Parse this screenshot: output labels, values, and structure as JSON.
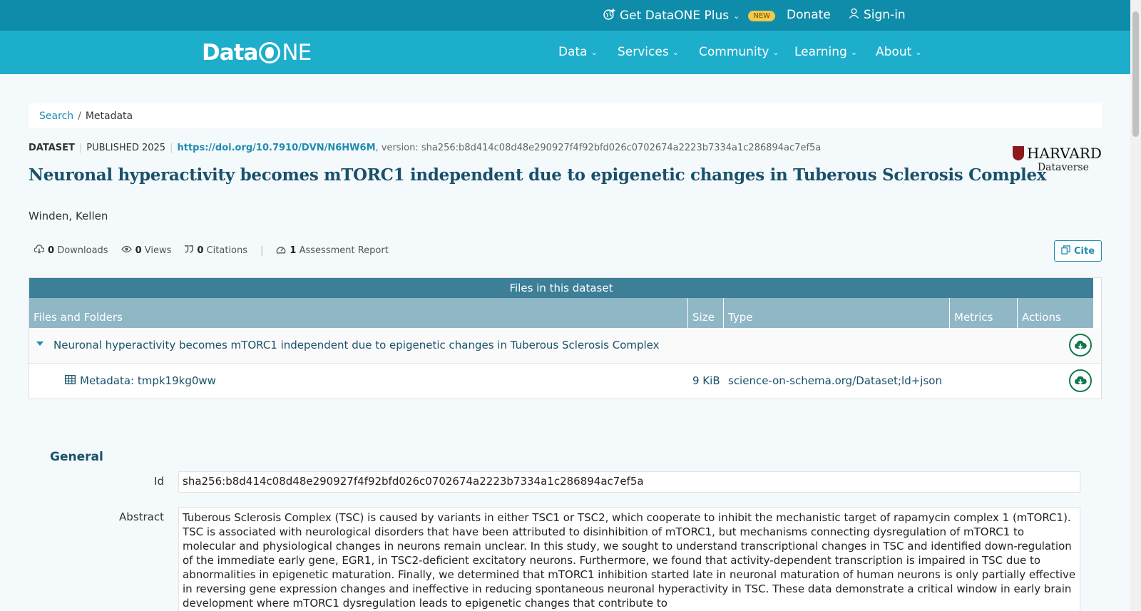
{
  "topbar": {
    "plus_label": "Get DataONE Plus",
    "new_badge": "NEW",
    "donate": "Donate",
    "signin": "Sign-in"
  },
  "navbar": {
    "logo_data": "Data",
    "logo_ne": "NE",
    "items": [
      "Data",
      "Services",
      "Community",
      "Learning",
      "About"
    ]
  },
  "breadcrumb": {
    "search": "Search",
    "separator": "/",
    "current": "Metadata"
  },
  "dataset": {
    "type": "DATASET",
    "published": "PUBLISHED 2025",
    "doi": "https://doi.org/10.7910/DVN/N6HW6M",
    "version": ", version: sha256:b8d414c08d48e290927f4f92bfd026c0702674a2223b7334a1c286894ac7ef5a",
    "title": "Neuronal hyperactivity becomes mTORC1 independent due to epigenetic changes in Tuberous Sclerosis Complex",
    "author": "Winden, Kellen"
  },
  "repository": {
    "line1": "HARVARD",
    "line2": "Dataverse"
  },
  "metrics": {
    "downloads_count": "0",
    "downloads_label": "Downloads",
    "views_count": "0",
    "views_label": "Views",
    "citations_count": "0",
    "citations_label": "Citations",
    "separator": "|",
    "assessment_count": "1",
    "assessment_label": "Assessment Report"
  },
  "cite_button": "Cite",
  "files": {
    "header": "Files in this dataset",
    "columns": [
      "Files and Folders",
      "Size",
      "Type",
      "Metrics",
      "Actions"
    ],
    "folder_name": "Neuronal hyperactivity becomes mTORC1 independent due to epigenetic changes in Tuberous Sclerosis Complex",
    "file": {
      "name": "Metadata: tmpk19kg0ww",
      "size": "9 KiB",
      "type": "science-on-schema.org/Dataset;ld+json"
    }
  },
  "general": {
    "heading": "General",
    "id_label": "Id",
    "id_value": "sha256:b8d414c08d48e290927f4f92bfd026c0702674a2223b7334a1c286894ac7ef5a",
    "abstract_label": "Abstract",
    "abstract_value": "Tuberous Sclerosis Complex (TSC) is caused by variants in either TSC1 or TSC2, which cooperate to inhibit the mechanistic target of rapamycin complex 1 (mTORC1). TSC is associated with neurological disorders that have been attributed to disinhibition of mTORC1, but mechanisms connecting dysregulation of mTORC1 to molecular and physiological changes in neurons remain unclear. In this study, we sought to understand transcriptional changes in TSC and identified down-regulation of the immediate early gene, EGR1, in TSC2-deficient excitatory neurons. Furthermore, we found that activity-dependent transcription is impaired in TSC due to abnormalities in epigenetic maturation. Finally, we determined that mTORC1 inhibition started late in neuronal maturation of human neurons is only partially effective in reversing gene expression changes and ineffective in reducing spontaneous neuronal hyperactivity in TSC. These data demonstrate a critical window in early brain development where mTORC1 dysregulation leads to epigenetic changes that contribute to"
  },
  "colors": {
    "topbar": "#0f8caa",
    "navbar": "#1daecb",
    "title": "#19516b",
    "link": "#1f8cb0",
    "files_header": "#3c7f97",
    "files_columns": "#90b7c6"
  }
}
